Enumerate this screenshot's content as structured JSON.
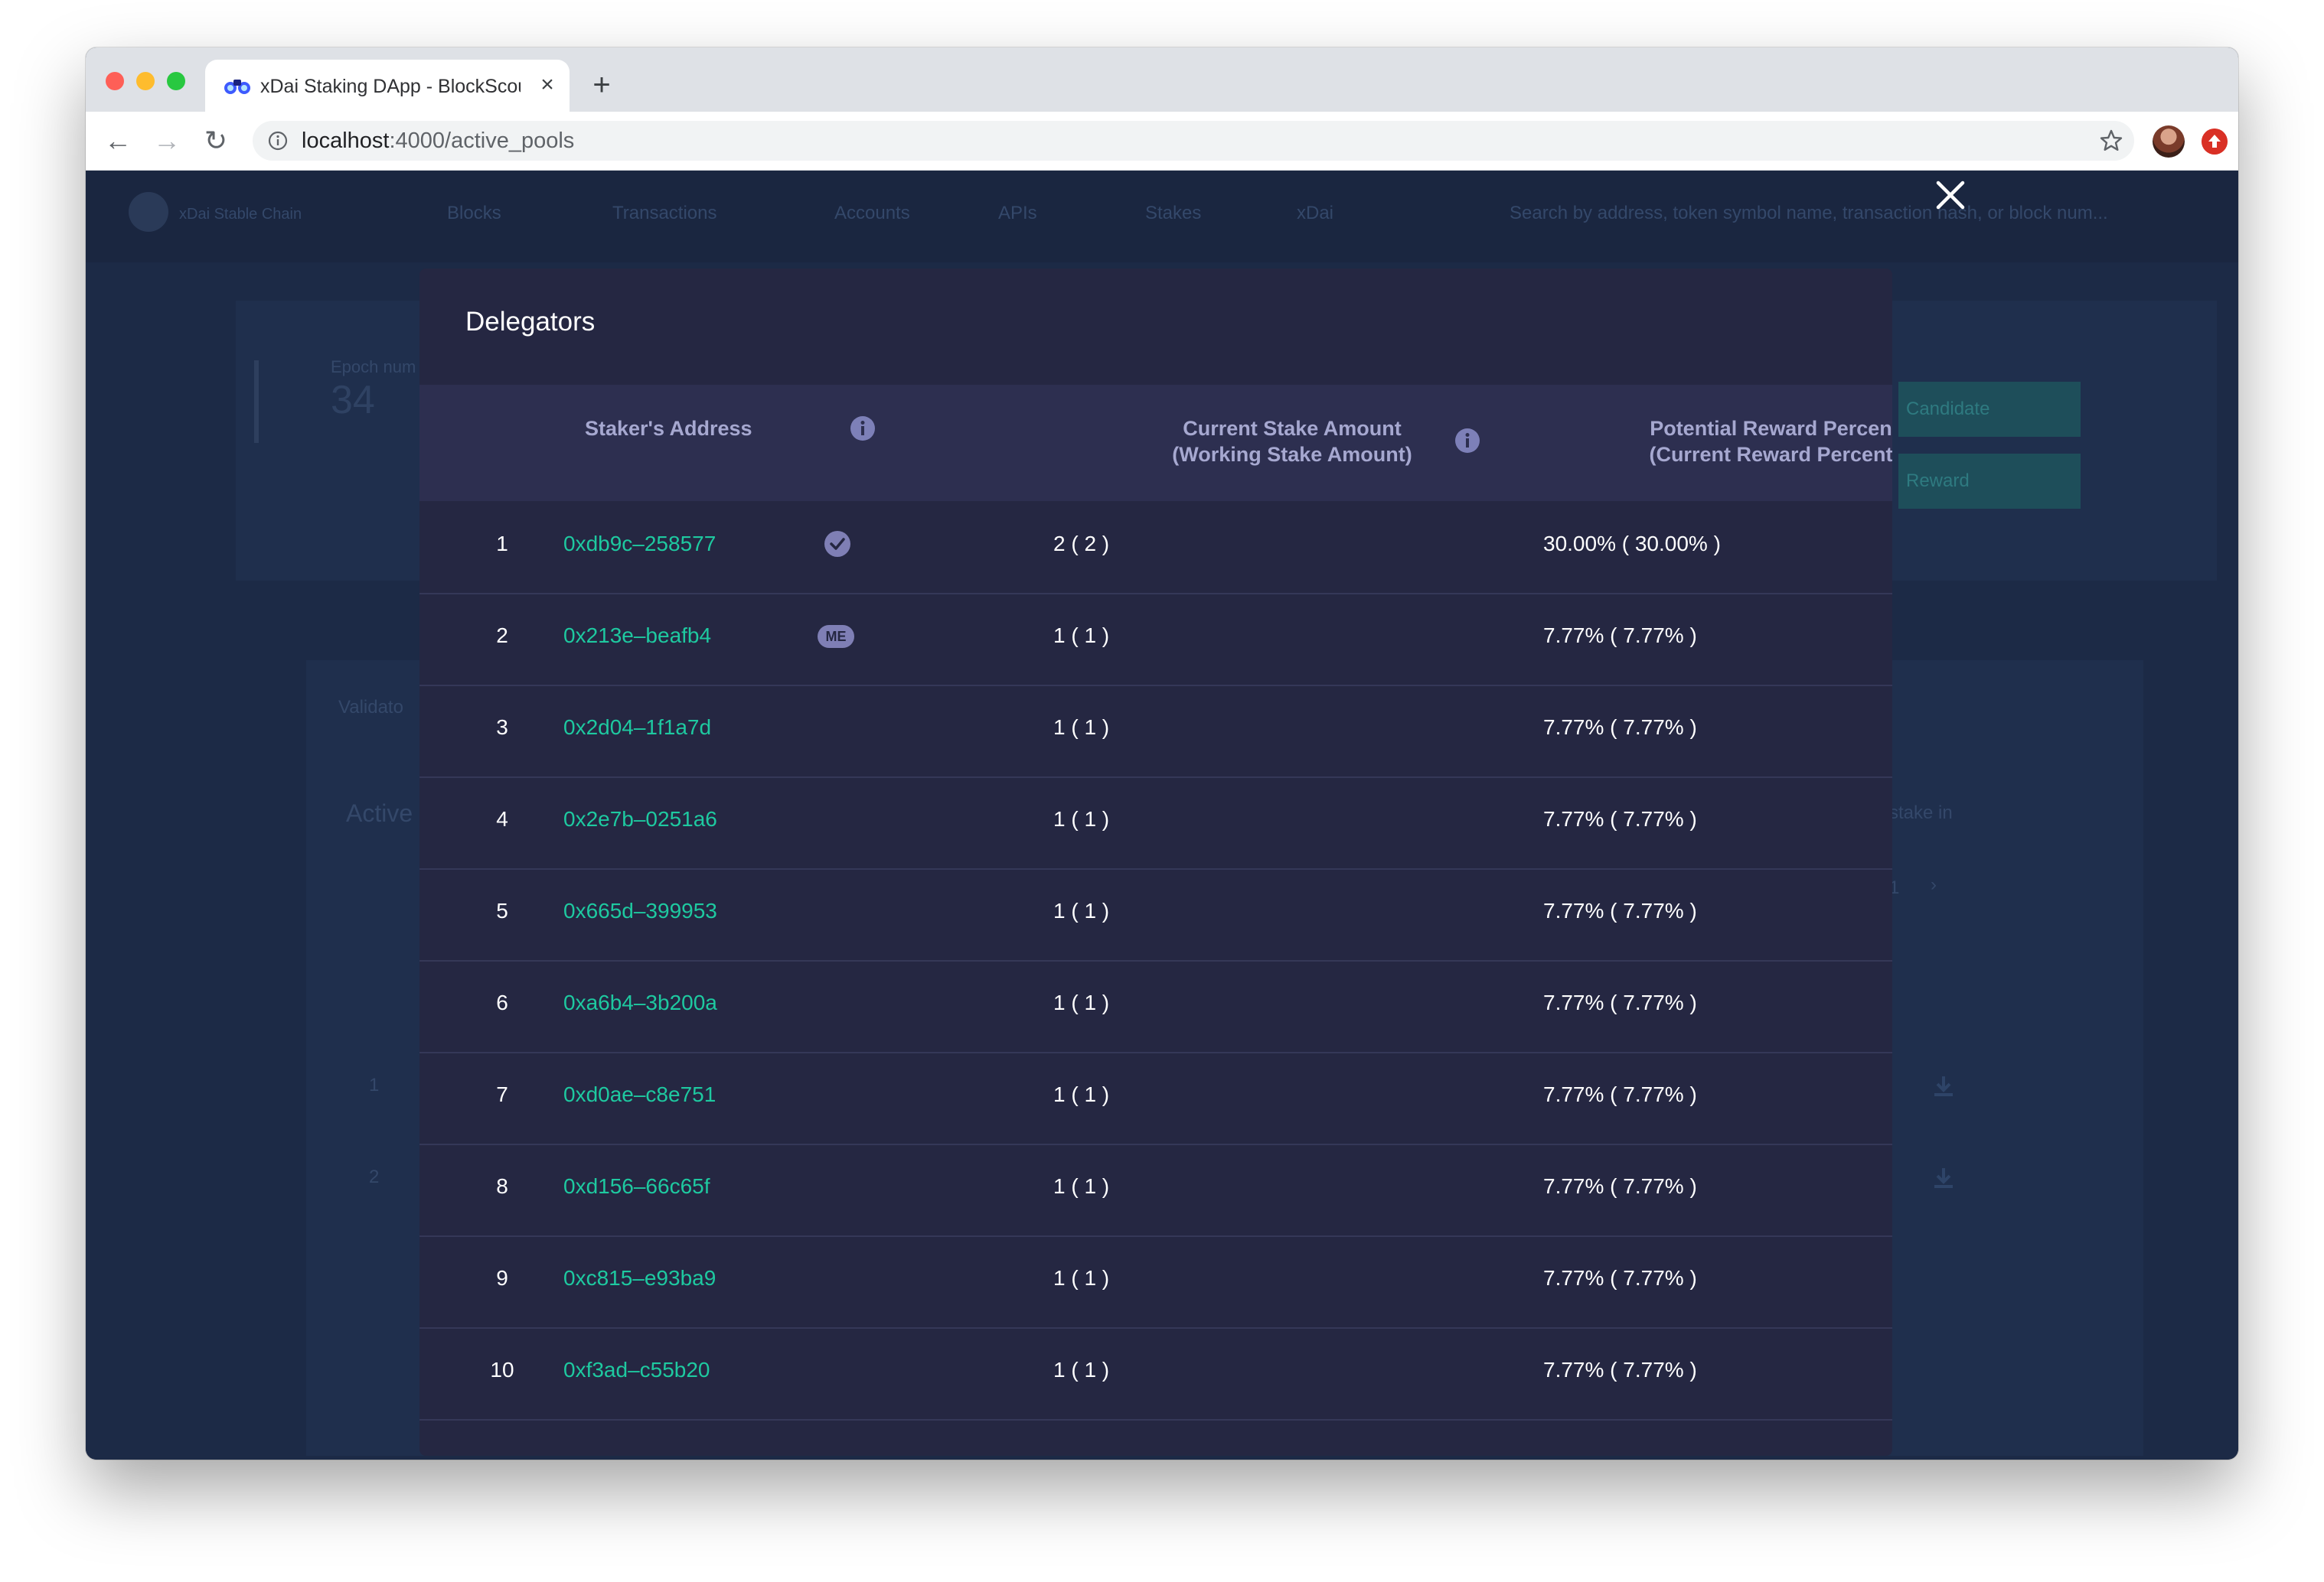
{
  "browser": {
    "tab_title": "xDai Staking DApp - BlockScout",
    "tab_close": "×",
    "new_tab": "+",
    "url_host": "localhost",
    "url_path": ":4000/active_pools",
    "back": "←",
    "forward": "→",
    "reload": "↻"
  },
  "background_page": {
    "brand": "xDai Stable Chain",
    "nav": [
      {
        "label": "Blocks"
      },
      {
        "label": "Transactions"
      },
      {
        "label": "Accounts"
      },
      {
        "label": "APIs"
      },
      {
        "label": "Stakes"
      },
      {
        "label": "xDai"
      }
    ],
    "search_placeholder": "Search by address, token symbol name, transaction hash, or block num...",
    "epoch_label": "Epoch num",
    "epoch_value": "34",
    "candidate_btn": "Candidate",
    "reward_btn": "Reward",
    "tab_validators": "Validato",
    "active_heading": "Active",
    "stake_in": "stake in",
    "pagination_page": "1",
    "pagination_next": "›",
    "row_numbers": [
      "1",
      "2"
    ]
  },
  "modal": {
    "title": "Delegators",
    "close_label": "Close",
    "columns": {
      "address": "Staker's Address",
      "stake_line1": "Current Stake Amount",
      "stake_line2": "(Working Stake Amount)",
      "reward_line1": "Potential Reward Percent",
      "reward_line2": "(Current Reward Percent)"
    },
    "me_badge": "ME",
    "rows": [
      {
        "index": "1",
        "address": "0xdb9c–258577",
        "stake": "2 ( 2 )",
        "reward": "30.00% ( 30.00% )"
      },
      {
        "index": "2",
        "address": "0x213e–beafb4",
        "stake": "1 ( 1 )",
        "reward": "7.77% ( 7.77% )"
      },
      {
        "index": "3",
        "address": "0x2d04–1f1a7d",
        "stake": "1 ( 1 )",
        "reward": "7.77% ( 7.77% )"
      },
      {
        "index": "4",
        "address": "0x2e7b–0251a6",
        "stake": "1 ( 1 )",
        "reward": "7.77% ( 7.77% )"
      },
      {
        "index": "5",
        "address": "0x665d–399953",
        "stake": "1 ( 1 )",
        "reward": "7.77% ( 7.77% )"
      },
      {
        "index": "6",
        "address": "0xa6b4–3b200a",
        "stake": "1 ( 1 )",
        "reward": "7.77% ( 7.77% )"
      },
      {
        "index": "7",
        "address": "0xd0ae–c8e751",
        "stake": "1 ( 1 )",
        "reward": "7.77% ( 7.77% )"
      },
      {
        "index": "8",
        "address": "0xd156–66c65f",
        "stake": "1 ( 1 )",
        "reward": "7.77% ( 7.77% )"
      },
      {
        "index": "9",
        "address": "0xc815–e93ba9",
        "stake": "1 ( 1 )",
        "reward": "7.77% ( 7.77% )"
      },
      {
        "index": "10",
        "address": "0xf3ad–c55b20",
        "stake": "1 ( 1 )",
        "reward": "7.77% ( 7.77% )"
      }
    ]
  },
  "colors": {
    "address_link": "#1ec9a0",
    "modal_bg": "#252742",
    "header_bg": "#2d2f50"
  }
}
